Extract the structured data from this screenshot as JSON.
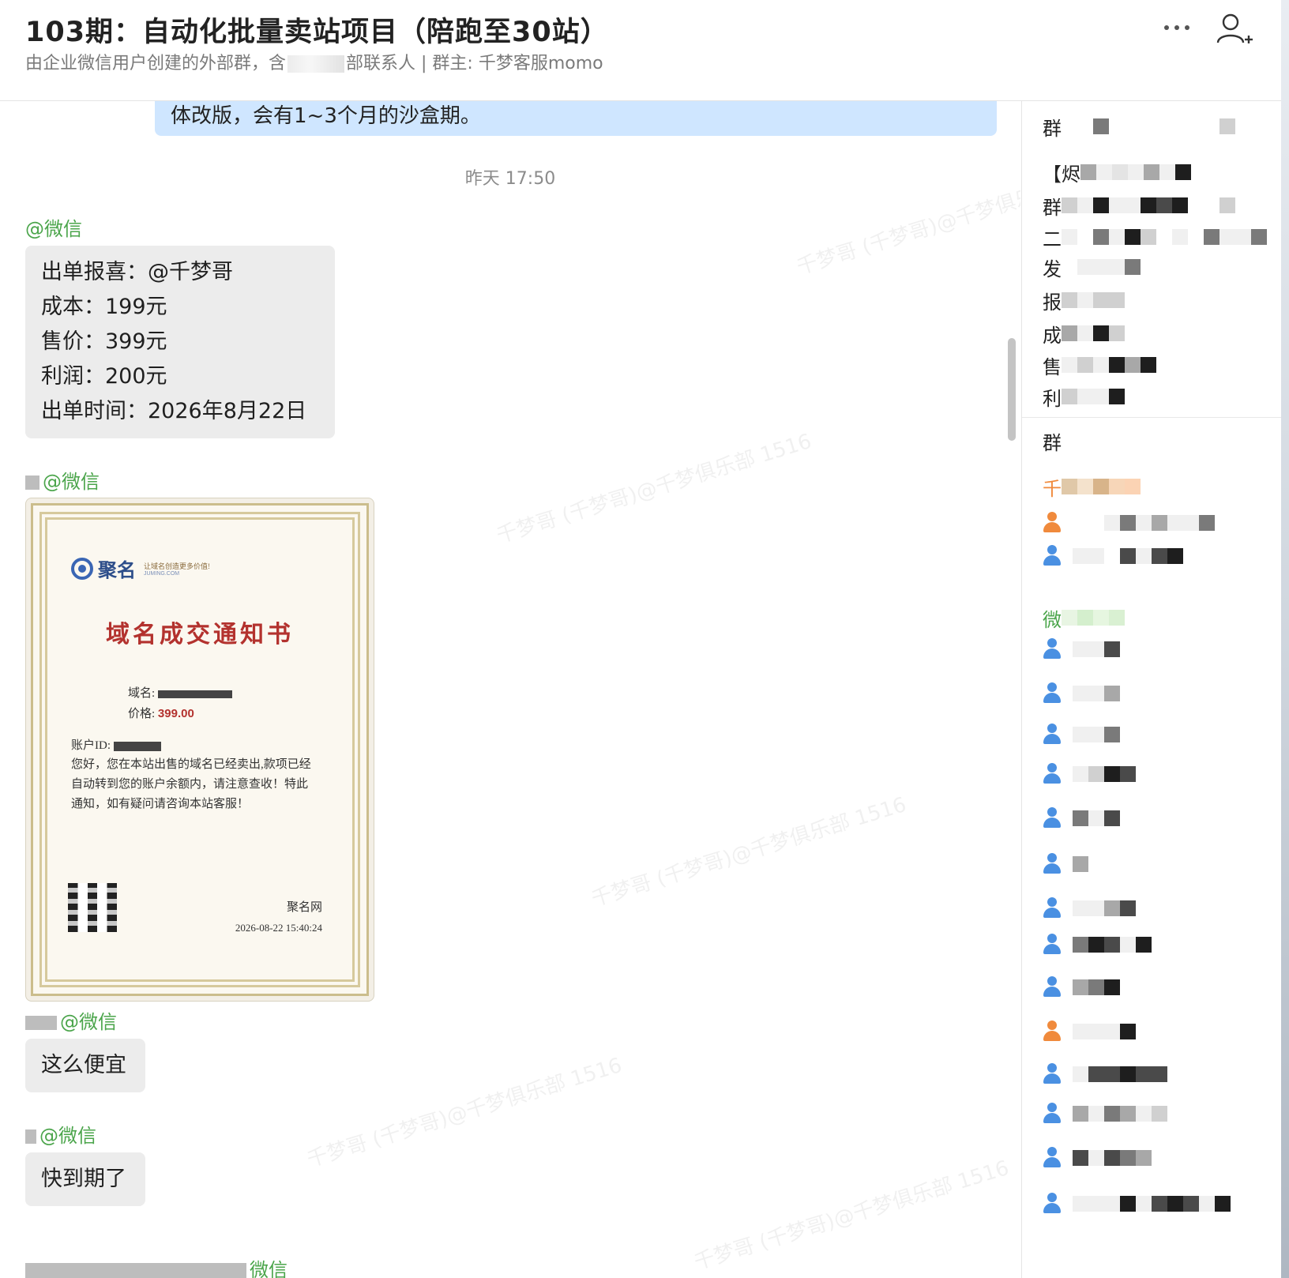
{
  "header": {
    "title": "103期：自动化批量卖站项目（陪跑至30站）",
    "subtitle_prefix": "由企业微信用户创建的外部群，含",
    "subtitle_suffix": "部联系人 | 群主: 千梦客服momo"
  },
  "chat": {
    "previous_message_tail": "体改版，会有1~3个月的沙盒期。",
    "timestamp": "昨天 17:50",
    "messages": [
      {
        "sender_suffix": "@微信",
        "lines": [
          "出单报喜：@千梦哥",
          "成本：199元",
          "售价：399元",
          "利润：200元",
          "出单时间：2026年8月22日"
        ]
      },
      {
        "sender_suffix": "@微信",
        "certificate": {
          "logo_text": "聚名",
          "logo_slogan": "让域名创造更多价值!",
          "logo_site": "JUMING.COM",
          "title": "域名成交通知书",
          "domain_label": "域名:",
          "price_label": "价格:",
          "price_value": "399.00",
          "account_label": "账户ID:",
          "body": "您好，您在本站出售的域名已经卖出,款项已经自动转到您的账户余额内，请注意查收！特此通知，如有疑问请咨询本站客服！",
          "signer": "聚名网",
          "datetime": "2026-08-22 15:40:24"
        }
      },
      {
        "sender_suffix": "@微信",
        "lines": [
          "这么便宜"
        ]
      },
      {
        "sender_suffix": "@微信",
        "lines": [
          "快到期了"
        ]
      },
      {
        "sender_suffix": "微信"
      }
    ],
    "watermark_text": "千梦哥 (千梦哥)@千梦俱乐部 1516"
  },
  "panel": {
    "info_rows": [
      "群",
      "【烬",
      "群",
      "二",
      "发",
      "报",
      "成",
      "售",
      "利"
    ],
    "section_label": "群",
    "owner_label": "千",
    "wechat_label": "微",
    "colors": {
      "member_blue": "#4a90e2",
      "member_orange": "#f08a3c",
      "wechat_green": "#4ba54b",
      "owner_orange": "#f08a3c"
    }
  }
}
